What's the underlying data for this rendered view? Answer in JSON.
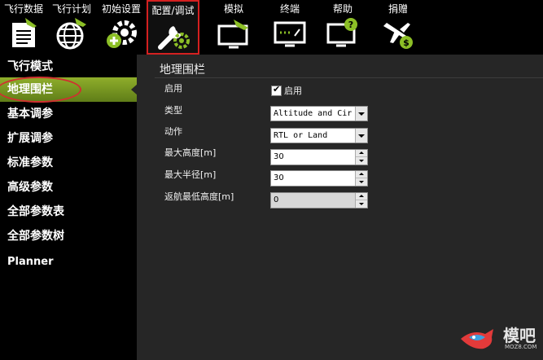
{
  "toolbar": {
    "items": [
      {
        "label": "飞行数据",
        "icon": "flight-data-icon"
      },
      {
        "label": "飞行计划",
        "icon": "globe-icon"
      },
      {
        "label": "初始设置",
        "icon": "gear-plus-icon"
      },
      {
        "label": "配置/调试",
        "icon": "wrench-gear-icon",
        "active": true
      },
      {
        "label": "模拟",
        "icon": "monitor-plane-icon"
      },
      {
        "label": "终端",
        "icon": "monitor-terminal-icon"
      },
      {
        "label": "帮助",
        "icon": "monitor-help-icon"
      },
      {
        "label": "捐赠",
        "icon": "plane-dollar-icon"
      }
    ]
  },
  "sidebar": {
    "items": [
      {
        "label": "飞行模式"
      },
      {
        "label": "地理围栏",
        "active": true
      },
      {
        "label": "基本调参"
      },
      {
        "label": "扩展调参"
      },
      {
        "label": "标准参数"
      },
      {
        "label": "高级参数"
      },
      {
        "label": "全部参数表"
      },
      {
        "label": "全部参数树"
      },
      {
        "label": "Planner"
      }
    ]
  },
  "geofence": {
    "title": "地理围栏",
    "enable_label": "启用",
    "enable_checkbox_label": "启用",
    "enabled": true,
    "type_label": "类型",
    "type_value": "Altitude and Cir",
    "action_label": "动作",
    "action_value": "RTL or Land",
    "max_alt_label": "最大高度[m]",
    "max_alt_value": "30",
    "max_radius_label": "最大半径[m]",
    "max_radius_value": "30",
    "rtl_min_alt_label": "返航最低高度[m]",
    "rtl_min_alt_value": "0"
  },
  "watermark": {
    "text": "模吧",
    "url": "MOZ8.COM"
  },
  "colors": {
    "active_green": "#7a9a22",
    "highlight_red": "#d42020",
    "icon_white": "#ffffff",
    "icon_green": "#8cbf26"
  }
}
